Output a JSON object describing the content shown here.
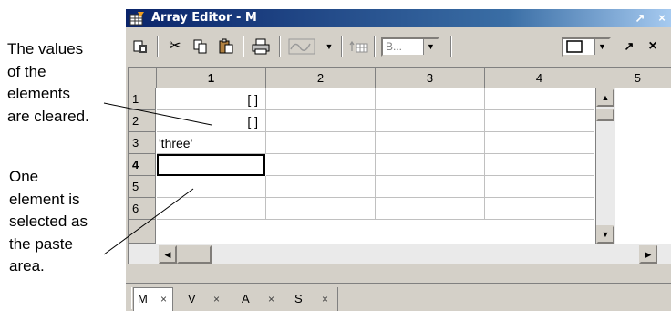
{
  "annotations": {
    "cleared": [
      "The values",
      "of the",
      "elements",
      "are cleared."
    ],
    "selected": [
      "One",
      "element is",
      "selected as",
      "the paste",
      "area."
    ]
  },
  "window": {
    "title": "Array Editor - M",
    "undock_glyph": "↗",
    "close_glyph": "×"
  },
  "toolbar": {
    "icons": [
      "import-data-icon",
      "cut-icon",
      "copy-icon",
      "paste-icon",
      "print-icon",
      "plot-icon",
      "plot-dropdown-icon",
      "variable-increment-icon"
    ],
    "base_combo": "B...",
    "docked_undock_glyph": "↗",
    "docked_close_glyph": "×"
  },
  "grid": {
    "columns": [
      "1",
      "2",
      "3",
      "4",
      "5"
    ],
    "rows": [
      {
        "label": "1",
        "col1": "[ ]"
      },
      {
        "label": "2",
        "col1": "[ ]"
      },
      {
        "label": "3",
        "col1": "'three'"
      },
      {
        "label": "4",
        "col1": ""
      },
      {
        "label": "5",
        "col1": ""
      },
      {
        "label": "6",
        "col1": ""
      }
    ],
    "selected_row": "4",
    "selected_col": "1"
  },
  "tabs": [
    {
      "label": "M",
      "close": "×"
    },
    {
      "label": "V",
      "close": "×"
    },
    {
      "label": "A",
      "close": "×"
    },
    {
      "label": "S",
      "close": "×"
    }
  ]
}
